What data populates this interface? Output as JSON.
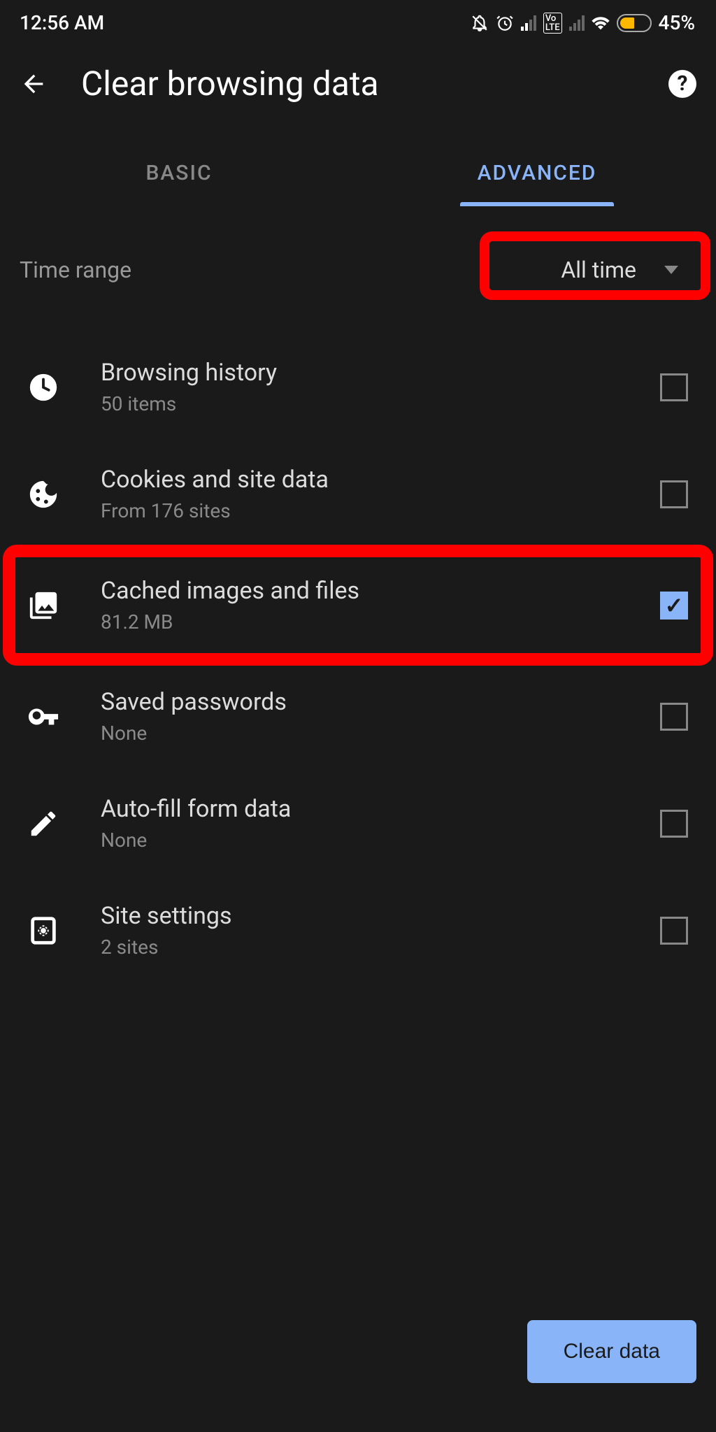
{
  "status_bar": {
    "time": "12:56 AM",
    "battery_percent": "45%"
  },
  "header": {
    "title": "Clear browsing data"
  },
  "tabs": {
    "basic": "BASIC",
    "advanced": "ADVANCED"
  },
  "time_range": {
    "label": "Time range",
    "value": "All time"
  },
  "items": [
    {
      "title": "Browsing history",
      "subtitle": "50 items",
      "checked": false,
      "icon": "clock"
    },
    {
      "title": "Cookies and site data",
      "subtitle": "From 176 sites",
      "checked": false,
      "icon": "cookie"
    },
    {
      "title": "Cached images and files",
      "subtitle": "81.2 MB",
      "checked": true,
      "icon": "images"
    },
    {
      "title": "Saved passwords",
      "subtitle": "None",
      "checked": false,
      "icon": "key"
    },
    {
      "title": "Auto-fill form data",
      "subtitle": "None",
      "checked": false,
      "icon": "pencil"
    },
    {
      "title": "Site settings",
      "subtitle": "2 sites",
      "checked": false,
      "icon": "settings-page"
    }
  ],
  "button": {
    "clear_data": "Clear data"
  }
}
